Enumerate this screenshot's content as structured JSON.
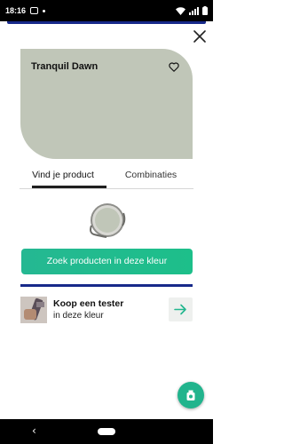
{
  "status_bar": {
    "time": "18:16"
  },
  "colors": {
    "swatch": "#c0c6b8",
    "accent_green": "#22b68e",
    "brand_blue": "#17298a"
  },
  "color_card": {
    "name": "Tranquil Dawn"
  },
  "tabs": [
    {
      "label": "Vind je product",
      "active": true
    },
    {
      "label": "Combinaties",
      "active": false
    }
  ],
  "cta": {
    "label": "Zoek producten in deze kleur"
  },
  "tester": {
    "title": "Koop een tester",
    "subtitle": "in deze kleur"
  },
  "icons": {
    "close": "close-icon",
    "heart": "heart-icon",
    "arrow": "arrow-right-icon",
    "fab": "paint-tester-icon",
    "back": "back-icon"
  }
}
